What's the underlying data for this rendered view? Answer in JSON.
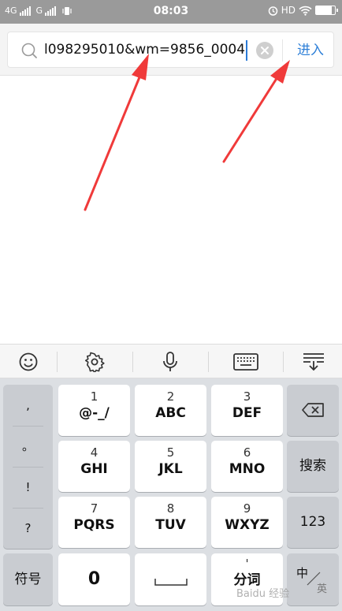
{
  "status_bar": {
    "left": "4G",
    "left2": "G",
    "time": "08:03",
    "right": "HD",
    "battery_level": 0.85
  },
  "url_bar": {
    "value": "l098295010&wm=9856_0004",
    "enter_label": "进入"
  },
  "keyboard": {
    "toolbar_icons": [
      "emoji-icon",
      "settings-icon",
      "microphone-icon",
      "keyboard-icon",
      "collapse-keyboard-icon"
    ],
    "punctuation": [
      ",",
      "。",
      "!",
      "?"
    ],
    "keys": [
      {
        "num": "1",
        "letters": "@-_/"
      },
      {
        "num": "2",
        "letters": "ABC"
      },
      {
        "num": "3",
        "letters": "DEF"
      },
      {
        "num": "4",
        "letters": "GHI"
      },
      {
        "num": "5",
        "letters": "JKL"
      },
      {
        "num": "6",
        "letters": "MNO"
      },
      {
        "num": "7",
        "letters": "PQRS"
      },
      {
        "num": "8",
        "letters": "TUV"
      },
      {
        "num": "9",
        "letters": "WXYZ"
      }
    ],
    "search_label": "搜索",
    "numeric_label": "123",
    "symbols_label": "符号",
    "zero_label": "0",
    "segment_label": "分词",
    "segment_mark": "'",
    "lang_cn": "中",
    "lang_en": "英"
  },
  "watermark": "Baidu 经验",
  "colors": {
    "accent": "#2f80d8",
    "arrow": "#f03a3a",
    "status_bar": "#9a9a9a"
  }
}
